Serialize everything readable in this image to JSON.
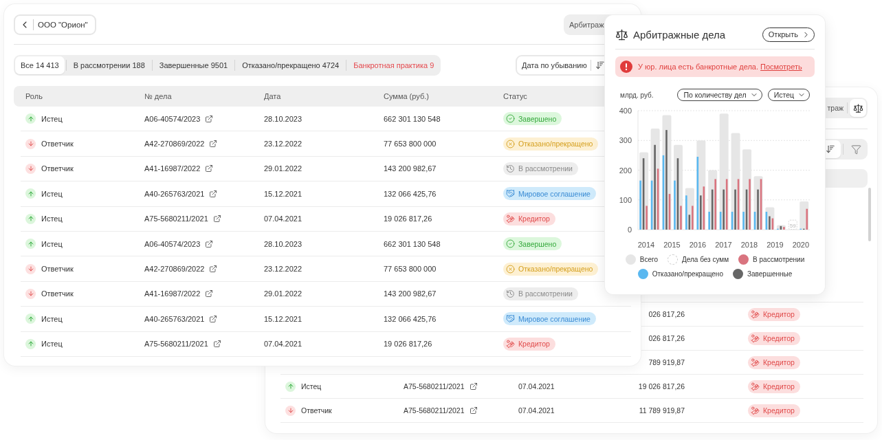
{
  "main_card": {
    "back_button": {
      "label": "ООО \"Орион\""
    },
    "view_switch": [
      {
        "label": "Арбитраж",
        "selected": false
      }
    ],
    "tabs": [
      {
        "label": "Все 14 413",
        "selected": true,
        "alert": false
      },
      {
        "label": "В рассмотрении 188",
        "selected": false,
        "alert": false
      },
      {
        "label": "Завершенные 9501",
        "selected": false,
        "alert": false
      },
      {
        "label": "Отказано/прекращено 4724",
        "selected": false,
        "alert": false
      },
      {
        "label": "Банкротная практика 9",
        "selected": false,
        "alert": true
      }
    ],
    "sort": {
      "label": "Дата по убыванию"
    },
    "table": {
      "columns": [
        "Роль",
        "№ дела",
        "Дата",
        "Сумма (руб.)",
        "Статус"
      ],
      "rows": [
        {
          "role": {
            "kind": "plaintiff",
            "label": "Истец"
          },
          "case_number": "А06-40574/2023",
          "date": "28.10.2023",
          "amount": "662 301 130 548",
          "status": {
            "kind": "done",
            "label": "Завершено"
          }
        },
        {
          "role": {
            "kind": "defendant",
            "label": "Ответчик"
          },
          "case_number": "А42-270869/2022",
          "date": "23.12.2022",
          "amount": "77 653 800 000",
          "status": {
            "kind": "refused",
            "label": "Отказано/прекращено"
          }
        },
        {
          "role": {
            "kind": "defendant",
            "label": "Ответчик"
          },
          "case_number": "А41-16987/2022",
          "date": "29.01.2022",
          "amount": "143 200 982,67",
          "status": {
            "kind": "pending",
            "label": "В рассмотрении"
          }
        },
        {
          "role": {
            "kind": "plaintiff",
            "label": "Истец"
          },
          "case_number": "А40-265763/2021",
          "date": "15.12.2021",
          "amount": "132 066 425,76",
          "status": {
            "kind": "settlement",
            "label": "Мировое соглашение"
          }
        },
        {
          "role": {
            "kind": "plaintiff",
            "label": "Истец"
          },
          "case_number": "А75-5680211/2021",
          "date": "07.04.2021",
          "amount": "19 026 817,26",
          "status": {
            "kind": "creditor",
            "label": "Кредитор"
          }
        },
        {
          "role": {
            "kind": "plaintiff",
            "label": "Истец"
          },
          "case_number": "А06-40574/2023",
          "date": "28.10.2023",
          "amount": "662 301 130 548",
          "status": {
            "kind": "done",
            "label": "Завершено"
          }
        },
        {
          "role": {
            "kind": "defendant",
            "label": "Ответчик"
          },
          "case_number": "А42-270869/2022",
          "date": "23.12.2022",
          "amount": "77 653 800 000",
          "status": {
            "kind": "refused",
            "label": "Отказано/прекращено"
          }
        },
        {
          "role": {
            "kind": "defendant",
            "label": "Ответчик"
          },
          "case_number": "А41-16987/2022",
          "date": "29.01.2022",
          "amount": "143 200 982,67",
          "status": {
            "kind": "pending",
            "label": "В рассмотрении"
          }
        },
        {
          "role": {
            "kind": "plaintiff",
            "label": "Истец"
          },
          "case_number": "А40-265763/2021",
          "date": "15.12.2021",
          "amount": "132 066 425,76",
          "status": {
            "kind": "settlement",
            "label": "Мировое соглашение"
          }
        },
        {
          "role": {
            "kind": "plaintiff",
            "label": "Истец"
          },
          "case_number": "А75-5680211/2021",
          "date": "07.04.2021",
          "amount": "19 026 817,26",
          "status": {
            "kind": "creditor",
            "label": "Кредитор"
          }
        }
      ]
    }
  },
  "popup": {
    "title": "Арбитражные дела",
    "open_button": "Открыть",
    "alert": {
      "text": "У юр. лица есть банкротные дела.",
      "link": "Посмотреть"
    },
    "unit": "млрд. руб.",
    "filters": [
      {
        "label": "По количеству дел"
      },
      {
        "label": "Истец"
      }
    ],
    "chart_data": {
      "type": "bar",
      "x": [
        2013.91,
        2014.35,
        2014.8,
        2015.24,
        2015.69,
        2016.13,
        2016.58,
        2017.02,
        2017.47,
        2017.91,
        2018.35,
        2018.8,
        2019.24,
        2019.69,
        2020.13
      ],
      "xlim": [
        2013.68,
        2020.35
      ],
      "xticks": [
        2014,
        2015,
        2016,
        2017,
        2018,
        2019,
        2020
      ],
      "ylim": [
        0,
        400
      ],
      "yticks": [
        0,
        100,
        200,
        300,
        400
      ],
      "grid": true,
      "series": [
        {
          "name": "Всего",
          "color": "#e6e6e6",
          "values": [
            260,
            340,
            385,
            285,
            140,
            300,
            200,
            390,
            325,
            270,
            180,
            75,
            15,
            null,
            95
          ]
        },
        {
          "name": "Дела без сумм",
          "color": "#cccccc",
          "values": [
            null,
            null,
            null,
            null,
            null,
            null,
            null,
            null,
            null,
            null,
            null,
            null,
            null,
            32,
            null
          ]
        },
        {
          "name": "В рассмотрении",
          "color": "#d9747f",
          "values": [
            80,
            205,
            120,
            80,
            80,
            145,
            170,
            170,
            170,
            170,
            170,
            38,
            9,
            null,
            70
          ]
        },
        {
          "name": "Отказано/прекращено",
          "color": "#5ab8f0",
          "values": [
            165,
            165,
            250,
            165,
            115,
            245,
            60,
            60,
            60,
            60,
            60,
            60,
            3,
            null,
            3
          ]
        },
        {
          "name": "Завершенные",
          "color": "#666666",
          "values": [
            240,
            285,
            335,
            240,
            50,
            115,
            135,
            135,
            135,
            135,
            135,
            45,
            12,
            null,
            3
          ]
        }
      ],
      "annotations": [
        "59"
      ]
    }
  },
  "back_card": {
    "view_switch": [
      {
        "kind": "text",
        "label": "траж",
        "selected": false
      },
      {
        "kind": "icon",
        "selected": true
      }
    ],
    "toolbar": [
      {
        "kind": "sort",
        "selected": true
      },
      {
        "kind": "filter",
        "selected": false
      }
    ],
    "rows": [
      {
        "amount": "026 817,26",
        "status": {
          "kind": "creditor",
          "label": "Кредитор"
        }
      },
      {
        "amount": "026 817,26",
        "status": {
          "kind": "creditor",
          "label": "Кредитор"
        }
      },
      {
        "amount": "789 919,87",
        "status": {
          "kind": "creditor",
          "label": "Кредитор"
        }
      },
      {
        "role": {
          "kind": "plaintiff",
          "label": "Истец"
        },
        "case_number": "А75-5680211/2021",
        "date": "07.04.2021",
        "amount": "19 026 817,26",
        "status": {
          "kind": "creditor",
          "label": "Кредитор"
        }
      },
      {
        "role": {
          "kind": "defendant",
          "label": "Ответчик"
        },
        "case_number": "А75-5680211/2021",
        "date": "07.04.2021",
        "amount": "11 789 919,87",
        "status": {
          "kind": "creditor",
          "label": "Кредитор"
        }
      }
    ]
  }
}
